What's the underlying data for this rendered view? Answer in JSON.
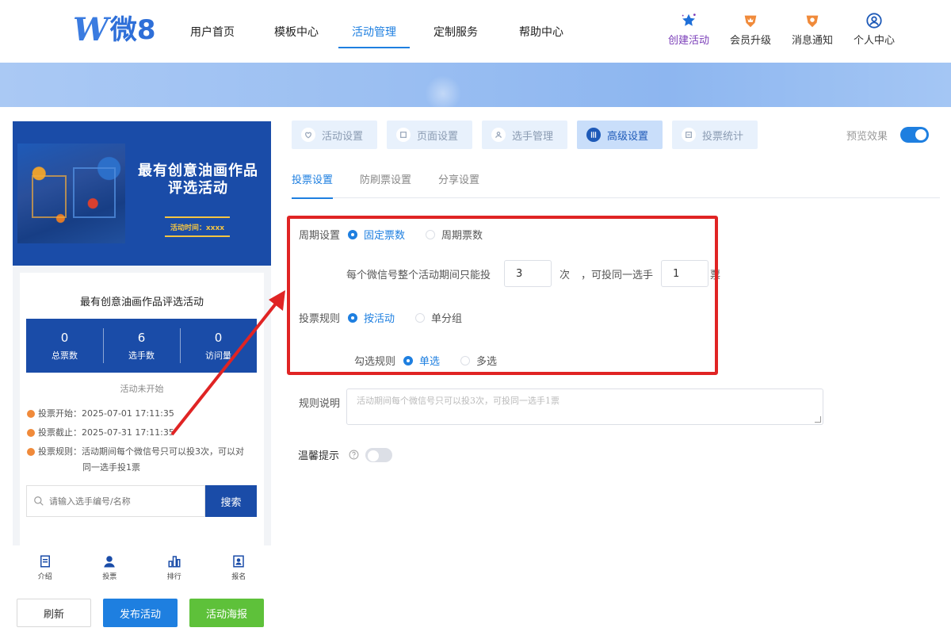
{
  "brand": {
    "logo_letter": "W",
    "logo_text": "微8"
  },
  "nav": [
    {
      "label": "用户首页",
      "active": false
    },
    {
      "label": "模板中心",
      "active": false
    },
    {
      "label": "活动管理",
      "active": true
    },
    {
      "label": "定制服务",
      "active": false
    },
    {
      "label": "帮助中心",
      "active": false
    }
  ],
  "tools": [
    {
      "label": "创建活动",
      "icon": "star-icon"
    },
    {
      "label": "会员升级",
      "icon": "crown-badge-icon"
    },
    {
      "label": "消息通知",
      "icon": "bell-badge-icon"
    },
    {
      "label": "个人中心",
      "icon": "user-circle-icon"
    }
  ],
  "preview": {
    "poster_title_line1": "最有创意油画作品",
    "poster_title_line2": "评选活动",
    "poster_time": "活动时间：xxxx",
    "card_title": "最有创意油画作品评选活动",
    "stats": [
      {
        "value": "0",
        "label": "总票数"
      },
      {
        "value": "6",
        "label": "选手数"
      },
      {
        "value": "0",
        "label": "访问量"
      }
    ],
    "status": "活动未开始",
    "vote_start": "投票开始：2025-07-01 17:11:35",
    "vote_end": "投票截止：2025-07-31 17:11:35",
    "vote_rule_line1": "投票规则：活动期间每个微信号只可以投3次，可以对",
    "vote_rule_line2": "同一选手投1票",
    "search_placeholder": "请输入选手编号/名称",
    "search_button": "搜索",
    "tabbar": [
      {
        "label": "介绍",
        "icon": "document-icon"
      },
      {
        "label": "投票",
        "icon": "person-icon"
      },
      {
        "label": "排行",
        "icon": "bar-chart-icon"
      },
      {
        "label": "报名",
        "icon": "signup-icon"
      }
    ]
  },
  "actions": {
    "refresh": "刷新",
    "publish": "发布活动",
    "poster": "活动海报"
  },
  "steps": [
    {
      "label": "活动设置",
      "icon": "heart-icon"
    },
    {
      "label": "页面设置",
      "icon": "page-icon"
    },
    {
      "label": "选手管理",
      "icon": "user-icon"
    },
    {
      "label": "高级设置",
      "icon": "sliders-icon",
      "active": true
    },
    {
      "label": "投票统计",
      "icon": "stats-icon"
    }
  ],
  "preview_toggle": {
    "label": "预览效果",
    "on": true
  },
  "subtabs": [
    {
      "label": "投票设置",
      "active": true
    },
    {
      "label": "防刷票设置",
      "active": false
    },
    {
      "label": "分享设置",
      "active": false
    }
  ],
  "form": {
    "cycle_label": "周期设置",
    "cycle_options": [
      "固定票数",
      "周期票数"
    ],
    "cycle_selected": "固定票数",
    "limit_prefix": "每个微信号整个活动期间只能投",
    "limit_times": "3",
    "limit_times_unit": "次",
    "limit_same_prefix": "，可投同一选手",
    "limit_same": "1",
    "limit_same_unit": "票",
    "rule_label": "投票规则",
    "rule_options": [
      "按活动",
      "单分组"
    ],
    "rule_selected": "按活动",
    "check_label": "勾选规则",
    "check_options": [
      "单选",
      "多选"
    ],
    "check_selected": "单选",
    "desc_label": "规则说明",
    "desc_placeholder": "活动期间每个微信号只可以投3次，可投同一选手1票",
    "tip_label": "温馨提示",
    "tip_on": false
  },
  "colors": {
    "accent": "#1e7fe0",
    "poster": "#1a4ca8",
    "annotation": "#e02424",
    "green": "#5ec13a"
  }
}
